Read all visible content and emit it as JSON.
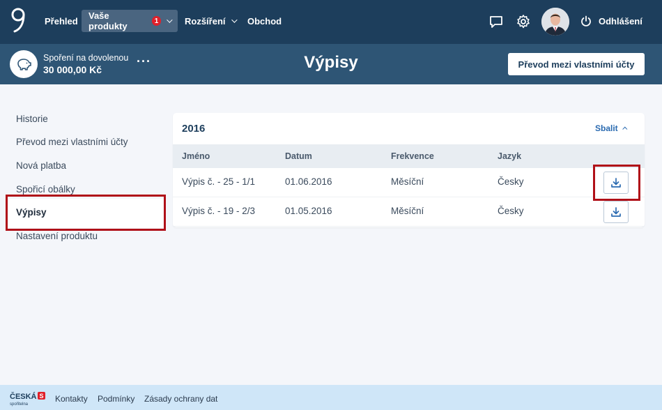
{
  "topnav": {
    "items": [
      {
        "label": "Přehled"
      },
      {
        "label": "Vaše produkty",
        "badge": "1"
      },
      {
        "label": "Rozšíření"
      },
      {
        "label": "Obchod"
      }
    ],
    "logout_label": "Odhlášení",
    "icons": [
      "logo-icon",
      "chat-icon",
      "settings-icon",
      "avatar",
      "power-icon"
    ]
  },
  "product": {
    "name": "Spoření na dovolenou",
    "balance": "30 000,00 Kč",
    "more": "···",
    "icon": "piggy-bank-icon"
  },
  "page": {
    "title": "Výpisy",
    "transfer_button": "Převod mezi vlastními účty"
  },
  "sidebar": {
    "items": [
      {
        "label": "Historie"
      },
      {
        "label": "Převod mezi vlastními účty"
      },
      {
        "label": "Nová platba"
      },
      {
        "label": "Spořicí obálky"
      },
      {
        "label": "Výpisy",
        "active": true
      },
      {
        "label": "Nastavení produktu"
      }
    ]
  },
  "statements": {
    "year": "2016",
    "collapse_label": "Sbalit",
    "columns": [
      "Jméno",
      "Datum",
      "Frekvence",
      "Jazyk"
    ],
    "rows": [
      {
        "name": "Výpis č. - 25 - 1/1",
        "date": "01.06.2016",
        "frequency": "Měsíční",
        "language": "Česky"
      },
      {
        "name": "Výpis č. - 19 - 2/3",
        "date": "01.05.2016",
        "frequency": "Měsíční",
        "language": "Česky"
      }
    ]
  },
  "footer": {
    "brand": "ČESKÁ spořitelna",
    "links": [
      "Kontakty",
      "Podmínky",
      "Zásady ochrany dat"
    ]
  },
  "colors": {
    "nav_bg": "#1d3e5c",
    "product_bar_bg": "#2e5575",
    "highlight": "#b01018",
    "link": "#2a6ab0",
    "footer_bg": "#cfe6f8"
  }
}
